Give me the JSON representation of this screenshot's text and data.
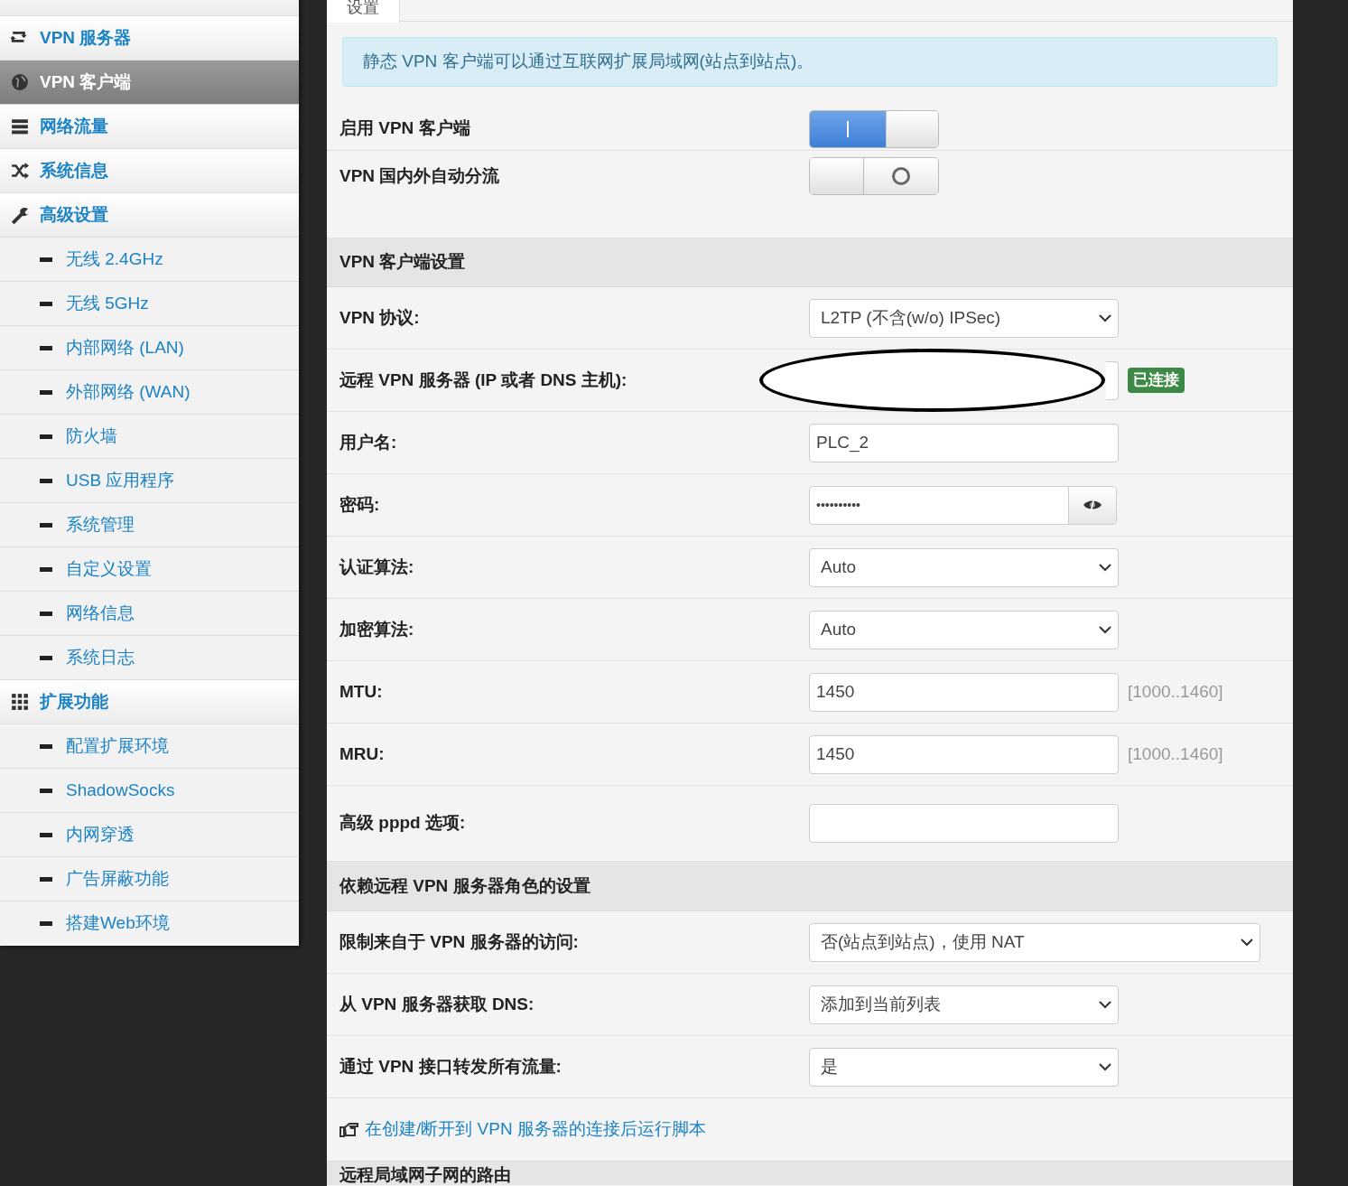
{
  "sidebar": {
    "items": [
      {
        "label": "VPN 服务器",
        "selected": false
      },
      {
        "label": "VPN 客户端",
        "selected": true
      },
      {
        "label": "网络流量",
        "selected": false
      },
      {
        "label": "系统信息",
        "selected": false
      },
      {
        "label": "高级设置",
        "selected": false,
        "children": [
          {
            "label": "无线 2.4GHz",
            "selected": false
          },
          {
            "label": "无线 5GHz",
            "selected": false
          },
          {
            "label": "内部网络 (LAN)",
            "selected": false
          },
          {
            "label": "外部网络 (WAN)",
            "selected": false
          },
          {
            "label": "防火墙",
            "selected": false
          },
          {
            "label": "USB 应用程序",
            "selected": false
          },
          {
            "label": "系统管理",
            "selected": false
          },
          {
            "label": "自定义设置",
            "selected": false
          },
          {
            "label": "网络信息",
            "selected": false
          },
          {
            "label": "系统日志",
            "selected": false
          }
        ]
      },
      {
        "label": "扩展功能",
        "selected": false,
        "children": [
          {
            "label": "配置扩展环境",
            "selected": false
          },
          {
            "label": "ShadowSocks",
            "selected": false
          },
          {
            "label": "内网穿透",
            "selected": false
          },
          {
            "label": "广告屏蔽功能",
            "selected": false
          },
          {
            "label": "搭建Web环境",
            "selected": false
          }
        ]
      }
    ]
  },
  "tabs": [
    {
      "label": "设置",
      "selected": true
    }
  ],
  "notice": "静态 VPN 客户端可以通过互联网扩展局域网(站点到站点)。",
  "general": [
    {
      "kind": "toggle",
      "label": "启用 VPN 客户端",
      "on": true
    },
    {
      "kind": "toggle",
      "label": "VPN 国内外自动分流",
      "on": false
    }
  ],
  "sections": [
    {
      "title": "VPN 客户端设置",
      "rows": [
        {
          "kind": "select",
          "label": "VPN 协议:",
          "value": "L2TP (不含(w/o) IPSec)"
        },
        {
          "kind": "input",
          "label": "远程 VPN 服务器 (IP 或者 DNS 主机):",
          "status": "已连接",
          "redacted": true
        },
        {
          "kind": "input",
          "label": "用户名:",
          "value": "PLC_2"
        },
        {
          "kind": "password",
          "label": "密码:",
          "value": "••••••••••"
        },
        {
          "kind": "select",
          "label": "认证算法:",
          "value": "Auto"
        },
        {
          "kind": "select",
          "label": "加密算法:",
          "value": "Auto"
        },
        {
          "kind": "input",
          "label": "MTU:",
          "value": "1450",
          "hint": "[1000..1460]"
        },
        {
          "kind": "input",
          "label": "MRU:",
          "value": "1450",
          "hint": "[1000..1460]"
        },
        {
          "kind": "input",
          "label": "高级 pppd 选项:"
        }
      ]
    },
    {
      "title": "依赖远程 VPN 服务器角色的设置",
      "rows": [
        {
          "kind": "select",
          "label": "限制来自于 VPN 服务器的访问:",
          "value": "否(站点到站点)，使用 NAT",
          "wide": true
        },
        {
          "kind": "select",
          "label": "从 VPN 服务器获取 DNS:",
          "value": "添加到当前列表"
        },
        {
          "kind": "select",
          "label": "通过 VPN 接口转发所有流量:",
          "value": "是"
        }
      ]
    }
  ],
  "script_link": "在创建/断开到 VPN 服务器的连接后运行脚本",
  "next_section": {
    "title": "远程局域网子网的路由"
  }
}
